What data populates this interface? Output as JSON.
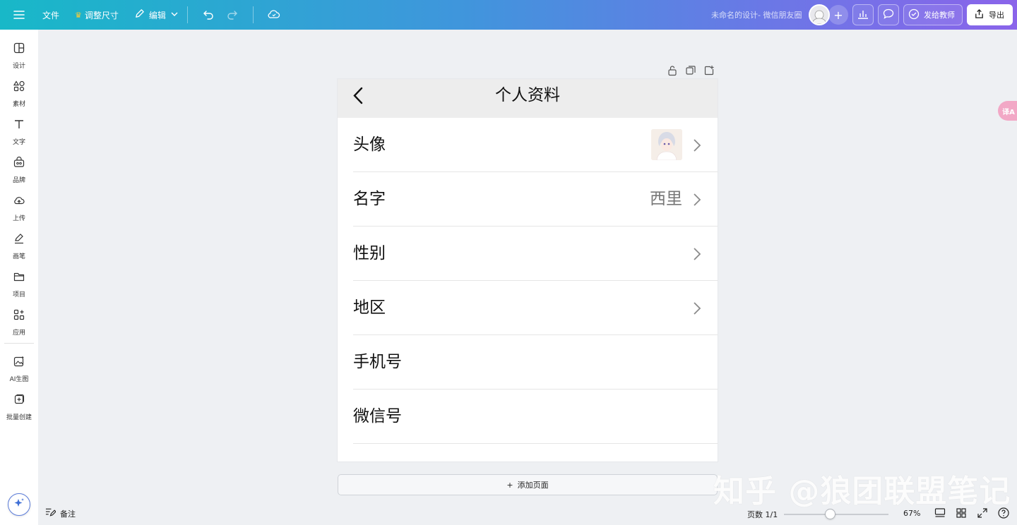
{
  "topbar": {
    "file_label": "文件",
    "resize_label": "调整尺寸",
    "edit_label": "编辑",
    "doc_title": "未命名的设计- 微信朋友圈",
    "send_label": "发给教师",
    "export_label": "导出"
  },
  "sidebar": {
    "items": [
      {
        "label": "设计",
        "icon": "layout-icon"
      },
      {
        "label": "素材",
        "icon": "shapes-icon"
      },
      {
        "label": "文字",
        "icon": "text-icon"
      },
      {
        "label": "品牌",
        "icon": "brand-icon"
      },
      {
        "label": "上传",
        "icon": "upload-cloud-icon"
      },
      {
        "label": "画笔",
        "icon": "pen-icon"
      },
      {
        "label": "项目",
        "icon": "folder-icon"
      },
      {
        "label": "应用",
        "icon": "apps-icon"
      },
      {
        "label": "AI生图",
        "icon": "ai-image-icon"
      },
      {
        "label": "批量创建",
        "icon": "batch-create-icon"
      }
    ]
  },
  "page": {
    "title": "个人资料",
    "rows": [
      {
        "label": "头像",
        "value": ""
      },
      {
        "label": "名字",
        "value": "西里"
      },
      {
        "label": "性别",
        "value": ""
      },
      {
        "label": "地区",
        "value": ""
      },
      {
        "label": "手机号",
        "value": ""
      },
      {
        "label": "微信号",
        "value": ""
      }
    ]
  },
  "canvas": {
    "add_page_label": "添加页面",
    "translate_badge": "译A"
  },
  "watermark": "知乎 @狼团联盟笔记",
  "bottombar": {
    "notes_label": "备注",
    "page_count": "页数 1/1",
    "zoom": "67%",
    "zoom_fraction": 0.44
  },
  "colors": {
    "topbar_gradient_start": "#18b8c8",
    "topbar_gradient_end": "#8a64ea",
    "page_header_bg": "#ededed",
    "canvas_bg": "#eef0f3"
  }
}
